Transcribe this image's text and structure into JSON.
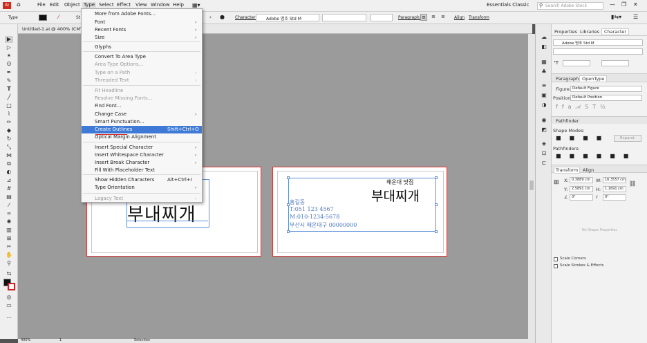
{
  "menubar": {
    "items": [
      "File",
      "Edit",
      "Object",
      "Type",
      "Select",
      "Effect",
      "View",
      "Window",
      "Help"
    ],
    "workspace": "Essentials Classic",
    "search_placeholder": "Search Adobe Stock"
  },
  "ctrlbar": {
    "mode": "Type",
    "character_label": "Character:",
    "font": "Adobe 명조 Std M",
    "paragraph_label": "Paragraph:",
    "align_label": "Align",
    "transform_label": "Transform",
    "stroke_label": "St"
  },
  "doc_tab": {
    "title": "Untitled-1.ai @ 400% (CMYK..."
  },
  "type_menu": {
    "items": [
      {
        "label": "More from Adobe Fonts...",
        "disabled": false,
        "shortcut": "",
        "submenu": false,
        "highlight": false
      },
      {
        "label": "Font",
        "disabled": false,
        "shortcut": "",
        "submenu": true,
        "highlight": false
      },
      {
        "label": "Recent Fonts",
        "disabled": false,
        "shortcut": "",
        "submenu": true,
        "highlight": false
      },
      {
        "label": "Size",
        "disabled": false,
        "shortcut": "",
        "submenu": true,
        "highlight": false
      },
      {
        "label": "Glyphs",
        "disabled": false,
        "shortcut": "",
        "submenu": false,
        "highlight": false
      },
      {
        "label": "Convert To Area Type",
        "disabled": false,
        "shortcut": "",
        "submenu": false,
        "highlight": false
      },
      {
        "label": "Area Type Options...",
        "disabled": true,
        "shortcut": "",
        "submenu": false,
        "highlight": false
      },
      {
        "label": "Type on a Path",
        "disabled": true,
        "shortcut": "",
        "submenu": true,
        "highlight": false
      },
      {
        "label": "Threaded Text",
        "disabled": true,
        "shortcut": "",
        "submenu": true,
        "highlight": false
      },
      {
        "label": "Fit Headline",
        "disabled": true,
        "shortcut": "",
        "submenu": false,
        "highlight": false
      },
      {
        "label": "Resolve Missing Fonts...",
        "disabled": true,
        "shortcut": "",
        "submenu": false,
        "highlight": false
      },
      {
        "label": "Find Font...",
        "disabled": false,
        "shortcut": "",
        "submenu": false,
        "highlight": false
      },
      {
        "label": "Change Case",
        "disabled": false,
        "shortcut": "",
        "submenu": true,
        "highlight": false
      },
      {
        "label": "Smart Punctuation...",
        "disabled": false,
        "shortcut": "",
        "submenu": false,
        "highlight": false
      },
      {
        "label": "Create Outlines",
        "disabled": false,
        "shortcut": "Shift+Ctrl+O",
        "submenu": false,
        "highlight": true
      },
      {
        "label": "Optical Margin Alignment",
        "disabled": false,
        "shortcut": "",
        "submenu": false,
        "highlight": false
      },
      {
        "label": "Insert Special Character",
        "disabled": false,
        "shortcut": "",
        "submenu": true,
        "highlight": false
      },
      {
        "label": "Insert Whitespace Character",
        "disabled": false,
        "shortcut": "",
        "submenu": true,
        "highlight": false
      },
      {
        "label": "Insert Break Character",
        "disabled": false,
        "shortcut": "",
        "submenu": true,
        "highlight": false
      },
      {
        "label": "Fill With Placeholder Text",
        "disabled": false,
        "shortcut": "",
        "submenu": false,
        "highlight": false
      },
      {
        "label": "Show Hidden Characters",
        "disabled": false,
        "shortcut": "Alt+Ctrl+I",
        "submenu": false,
        "highlight": false
      },
      {
        "label": "Type Orientation",
        "disabled": false,
        "shortcut": "",
        "submenu": true,
        "highlight": false
      },
      {
        "label": "Legacy Text",
        "disabled": true,
        "shortcut": "",
        "submenu": true,
        "highlight": false
      }
    ]
  },
  "artboard1": {
    "title_text": "부내찌개"
  },
  "artboard2": {
    "shop": "해운대 맛집",
    "title_text": "부대찌개",
    "name": "홍길동",
    "tel": "T:051  123  4567",
    "mobile": "M:010-1234-5678",
    "address": "부산시 해운대구 00000000"
  },
  "panel_char": {
    "tabs": [
      "Properties",
      "Libraries",
      "Character"
    ],
    "font": "Adobe 명조 Std M"
  },
  "panel_opentype": {
    "tabs": [
      "Paragraph",
      "OpenType"
    ],
    "figure_label": "Figure:",
    "figure_value": "Default Figure",
    "position_label": "Position:",
    "position_value": "Default Position"
  },
  "panel_pathfinder": {
    "title": "Pathfinder",
    "shape_modes": "Shape Modes:",
    "expand": "Expand",
    "pathfinders": "Pathfinders:"
  },
  "panel_transform": {
    "tabs": [
      "Transform",
      "Align"
    ],
    "x_label": "X:",
    "x_value": "0.3889 cm",
    "w_label": "W:",
    "w_value": "16.3557 cm",
    "y_label": "Y:",
    "y_value": "2.5891 cm",
    "h_label": "H:",
    "h_value": "1.1691 cm",
    "angle_value": "0°",
    "shear_value": "0°",
    "no_shape": "No Shape Properties",
    "scale_corners": "Scale Corners",
    "scale_strokes": "Scale Strokes & Effects"
  },
  "status": {
    "zoom": "400%",
    "page": "1",
    "selection": "Selection"
  },
  "colors": {
    "accent": "#3e7ad6",
    "artboard_border": "#dd3333",
    "selection": "#5a8fd6"
  }
}
